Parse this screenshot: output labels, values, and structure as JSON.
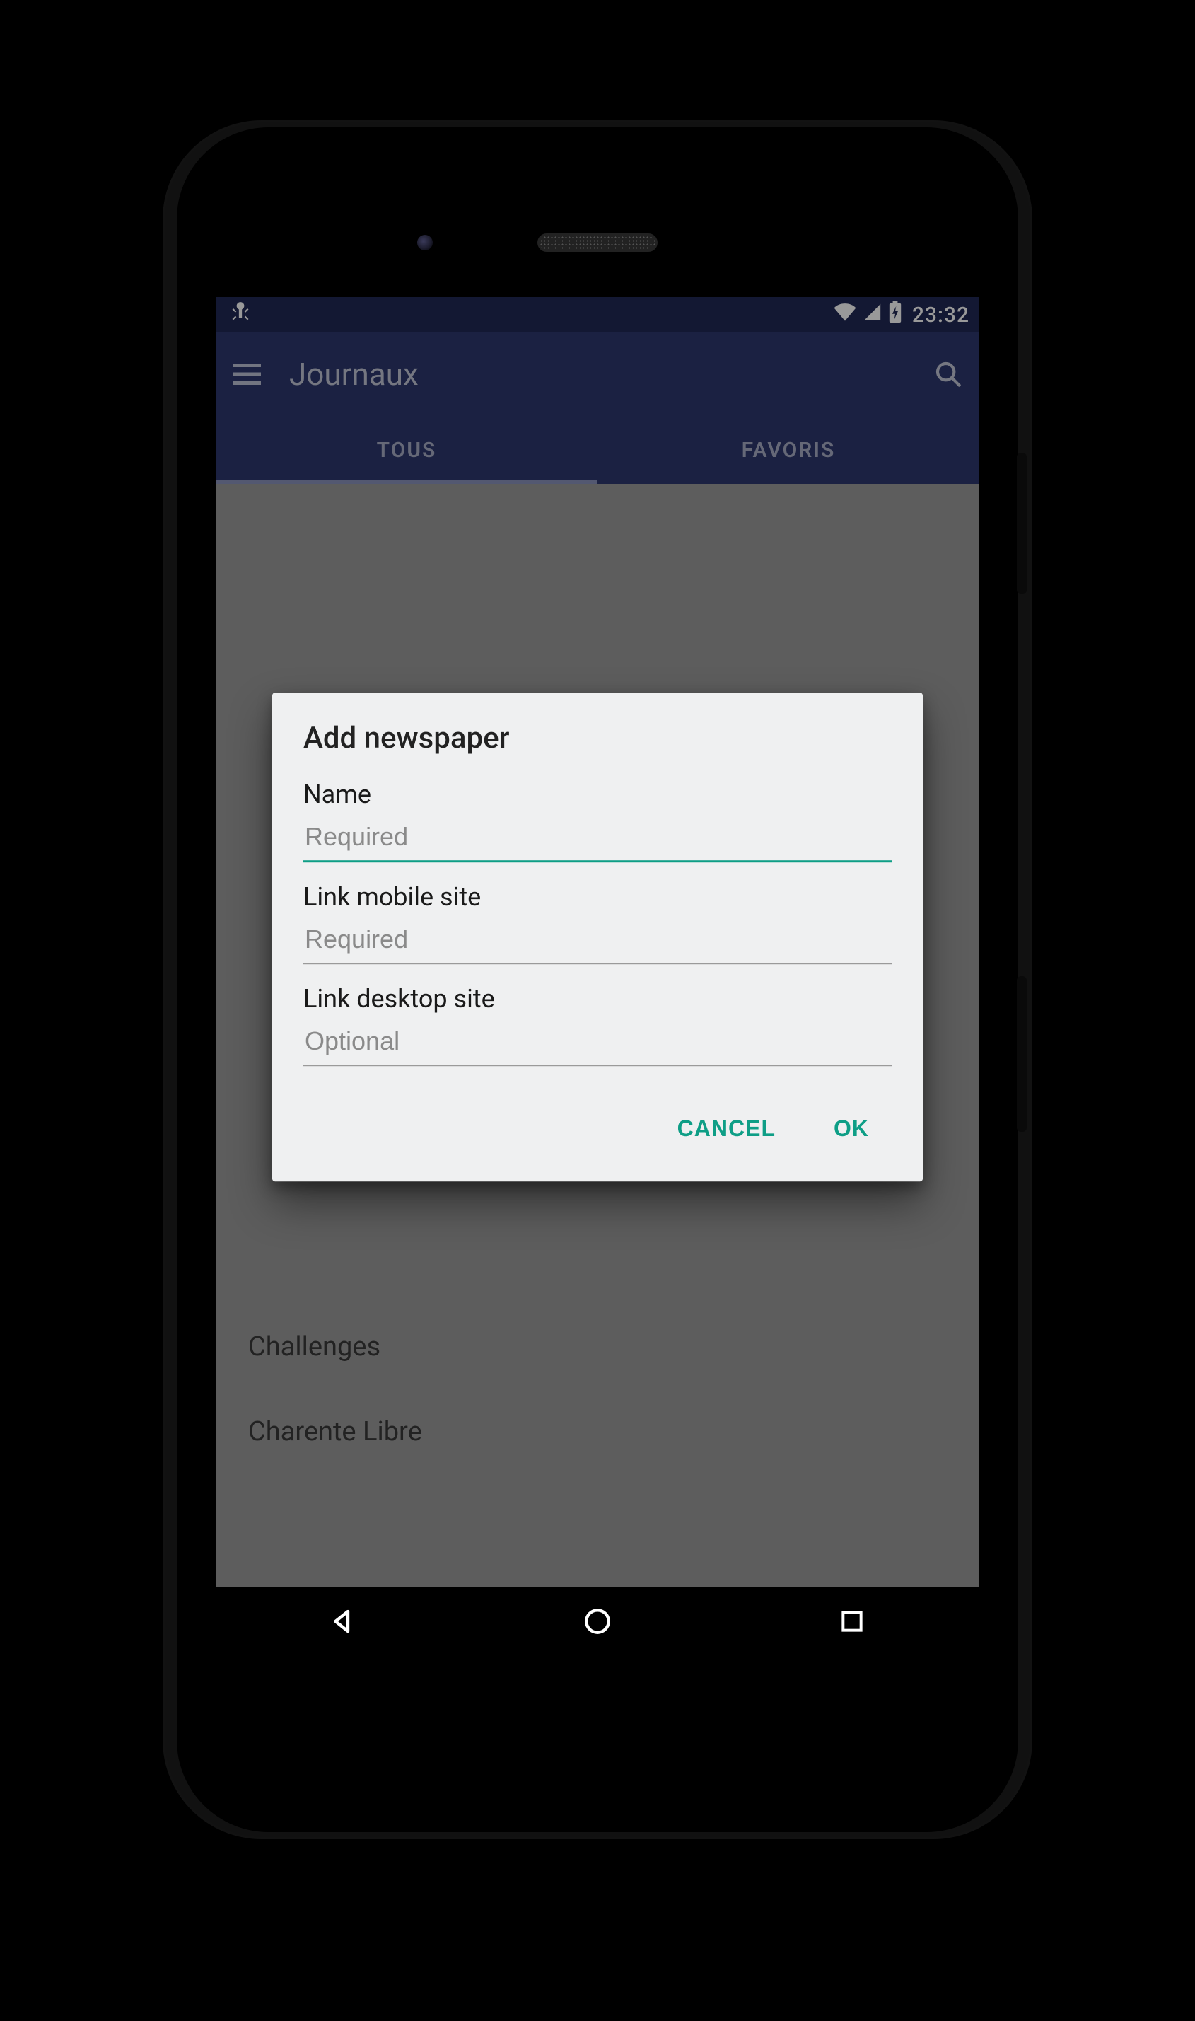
{
  "status": {
    "time": "23:32"
  },
  "appbar": {
    "title": "Journaux"
  },
  "tabs": {
    "tous": "TOUS",
    "favoris": "FAVORIS"
  },
  "list": {
    "items": [
      "Challenges",
      "Charente Libre"
    ]
  },
  "dialog": {
    "title": "Add newspaper",
    "fields": {
      "name": {
        "label": "Name",
        "placeholder": "Required"
      },
      "mobile": {
        "label": "Link mobile site",
        "placeholder": "Required"
      },
      "desktop": {
        "label": "Link desktop site",
        "placeholder": "Optional"
      }
    },
    "actions": {
      "cancel": "CANCEL",
      "ok": "OK"
    }
  }
}
